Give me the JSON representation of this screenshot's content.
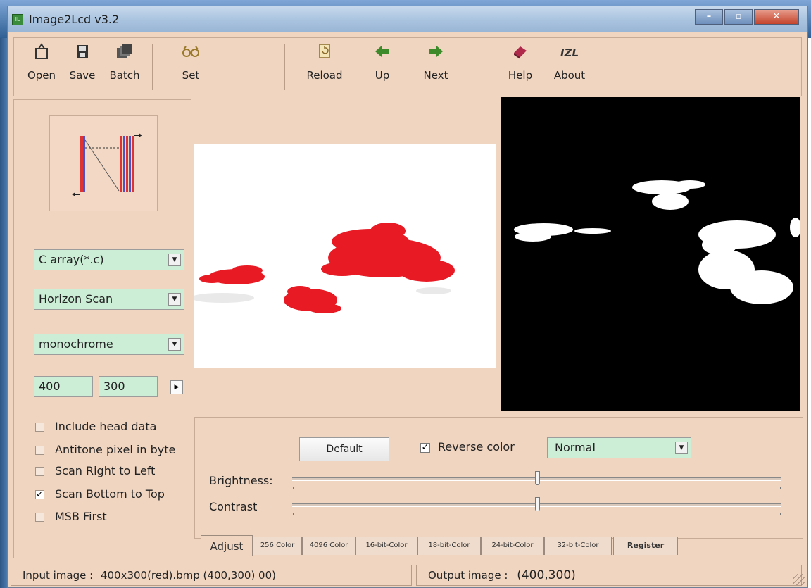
{
  "window": {
    "title": "Image2Lcd v3.2",
    "app_icon": "image2lcd-app-icon",
    "caption_buttons": {
      "minimize": "minimize-icon",
      "maximize": "maximize-icon",
      "close": "close-icon"
    }
  },
  "toolbar": {
    "open": "Open",
    "save": "Save",
    "batch": "Batch",
    "set": "Set",
    "reload": "Reload",
    "up": "Up",
    "next": "Next",
    "help": "Help",
    "about": "About",
    "about_glyph": "IZL"
  },
  "settings": {
    "output_type": "C array(*.c)",
    "scan_mode": "Horizon Scan",
    "color_depth": "monochrome",
    "width": "400",
    "height": "300",
    "options": {
      "include_head_data": {
        "label": "Include head data",
        "checked": false
      },
      "antitone_pixel": {
        "label": "Antitone pixel in byte",
        "checked": false
      },
      "scan_right_to_left": {
        "label": "Scan Right to Left",
        "checked": false
      },
      "scan_bottom_to_top": {
        "label": "Scan Bottom to Top",
        "checked": true
      },
      "msb_first": {
        "label": "MSB First",
        "checked": false
      }
    }
  },
  "adjust": {
    "default_label": "Default",
    "reverse_color_label": "Reverse color",
    "reverse_color_checked": true,
    "mode": "Normal",
    "brightness_label": "Brightness:",
    "contrast_label": "Contrast",
    "brightness_level": 0.5,
    "contrast_level": 0.5
  },
  "tabs": [
    "Adjust",
    "256 Color",
    "4096 Color",
    "16-bit-Color",
    "18-bit-Color",
    "24-bit-Color",
    "32-bit-Color",
    "Register"
  ],
  "status": {
    "input_label": "Input image :",
    "input_value": "400x300(red).bmp (400,300) 00)",
    "output_label": "Output image :",
    "output_value": "(400,300)"
  },
  "colors": {
    "window_bg": "#f0d5c1",
    "field_bg": "#cdeed6",
    "accent_red": "#e81b25",
    "output_bg": "#000000"
  }
}
